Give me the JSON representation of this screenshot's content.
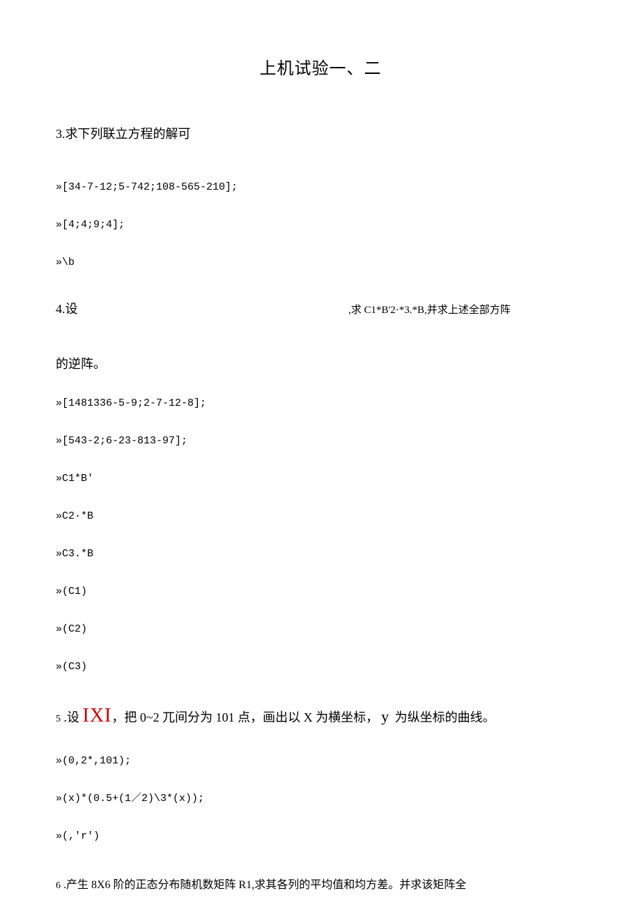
{
  "title": "上机试验一、二",
  "q3": {
    "heading": "3.求下列联立方程的解可",
    "lines": [
      "»[34-7-12;5-742;108-565-210];",
      "»[4;4;9;4];",
      "»\\b"
    ]
  },
  "q4": {
    "left": "4.设",
    "right": ",求 C1*B'2·*3.*B,并求上述全部方阵",
    "heading2": "的逆阵。",
    "lines": [
      "»[1481336-5-9;2-7-12-8];",
      "»[543-2;6-23-813-97];",
      "»C1*B'",
      "»C2·*B",
      "»C3.*B",
      "»(C1)",
      "»(C2)",
      "»(C3)"
    ]
  },
  "q5": {
    "prefix_num": "5",
    "prefix_dot": " .设 ",
    "ixi": "IXI",
    "mid": "，把 0~2 兀间分为 101 点，画出以 X 为横坐标，",
    "big_y": "y",
    "suffix": " 为纵坐标的曲线。",
    "lines": [
      "»(0,2*,101);",
      "»(x)*(0.5+(1／2)\\3*(x));",
      "»(,'r')"
    ]
  },
  "q6": {
    "prefix_num": "6",
    "text": " .产生 8X6 阶的正态分布随机数矩阵 R1,求其各列的平均值和均方差。并求该矩阵全"
  }
}
